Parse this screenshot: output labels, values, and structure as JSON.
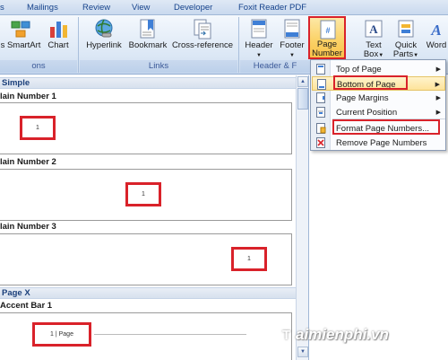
{
  "tabs": [
    {
      "label": "s",
      "id": "s"
    },
    {
      "label": "Mailings",
      "id": "mailings"
    },
    {
      "label": "Review",
      "id": "review"
    },
    {
      "label": "View",
      "id": "view"
    },
    {
      "label": "Developer",
      "id": "developer"
    },
    {
      "label": "Foxit Reader PDF",
      "id": "foxit"
    }
  ],
  "ribbon": {
    "smartart": "SmartArt",
    "chart": "Chart",
    "s_partial": "s",
    "hyperlink": "Hyperlink",
    "bookmark": "Bookmark",
    "crossref": "Cross-reference",
    "header": "Header",
    "footer": "Footer",
    "page_number_1": "Page",
    "page_number_2": "Number",
    "text_box_1": "Text",
    "text_box_2": "Box",
    "quick_parts_1": "Quick",
    "quick_parts_2": "Parts",
    "wordart": "Word",
    "group_illustrations": "ons",
    "group_links": "Links",
    "group_header_footer": "Header & F"
  },
  "gallery": {
    "header_simple": "Simple",
    "item1": "lain Number 1",
    "item2": "lain Number 2",
    "item3": "lain Number 3",
    "header_pagex": "Page X",
    "item4": "Accent Bar 1",
    "preview_num": "1",
    "preview_accent": "1 | Page"
  },
  "menu": {
    "items": [
      {
        "label": "Top of Page",
        "has_submenu": true
      },
      {
        "label": "Bottom of Page",
        "has_submenu": true
      },
      {
        "label": "Page Margins",
        "has_submenu": true
      },
      {
        "label": "Current Position",
        "has_submenu": true
      },
      {
        "label": "Format Page Numbers...",
        "has_submenu": false
      },
      {
        "label": "Remove Page Numbers",
        "has_submenu": false
      }
    ]
  },
  "watermark": "aimienphi.vn",
  "watermark_t": "T",
  "colors": {
    "highlight": "#d9222a",
    "ribbon_text": "#15428b",
    "menu_hover": "#fde39a"
  }
}
